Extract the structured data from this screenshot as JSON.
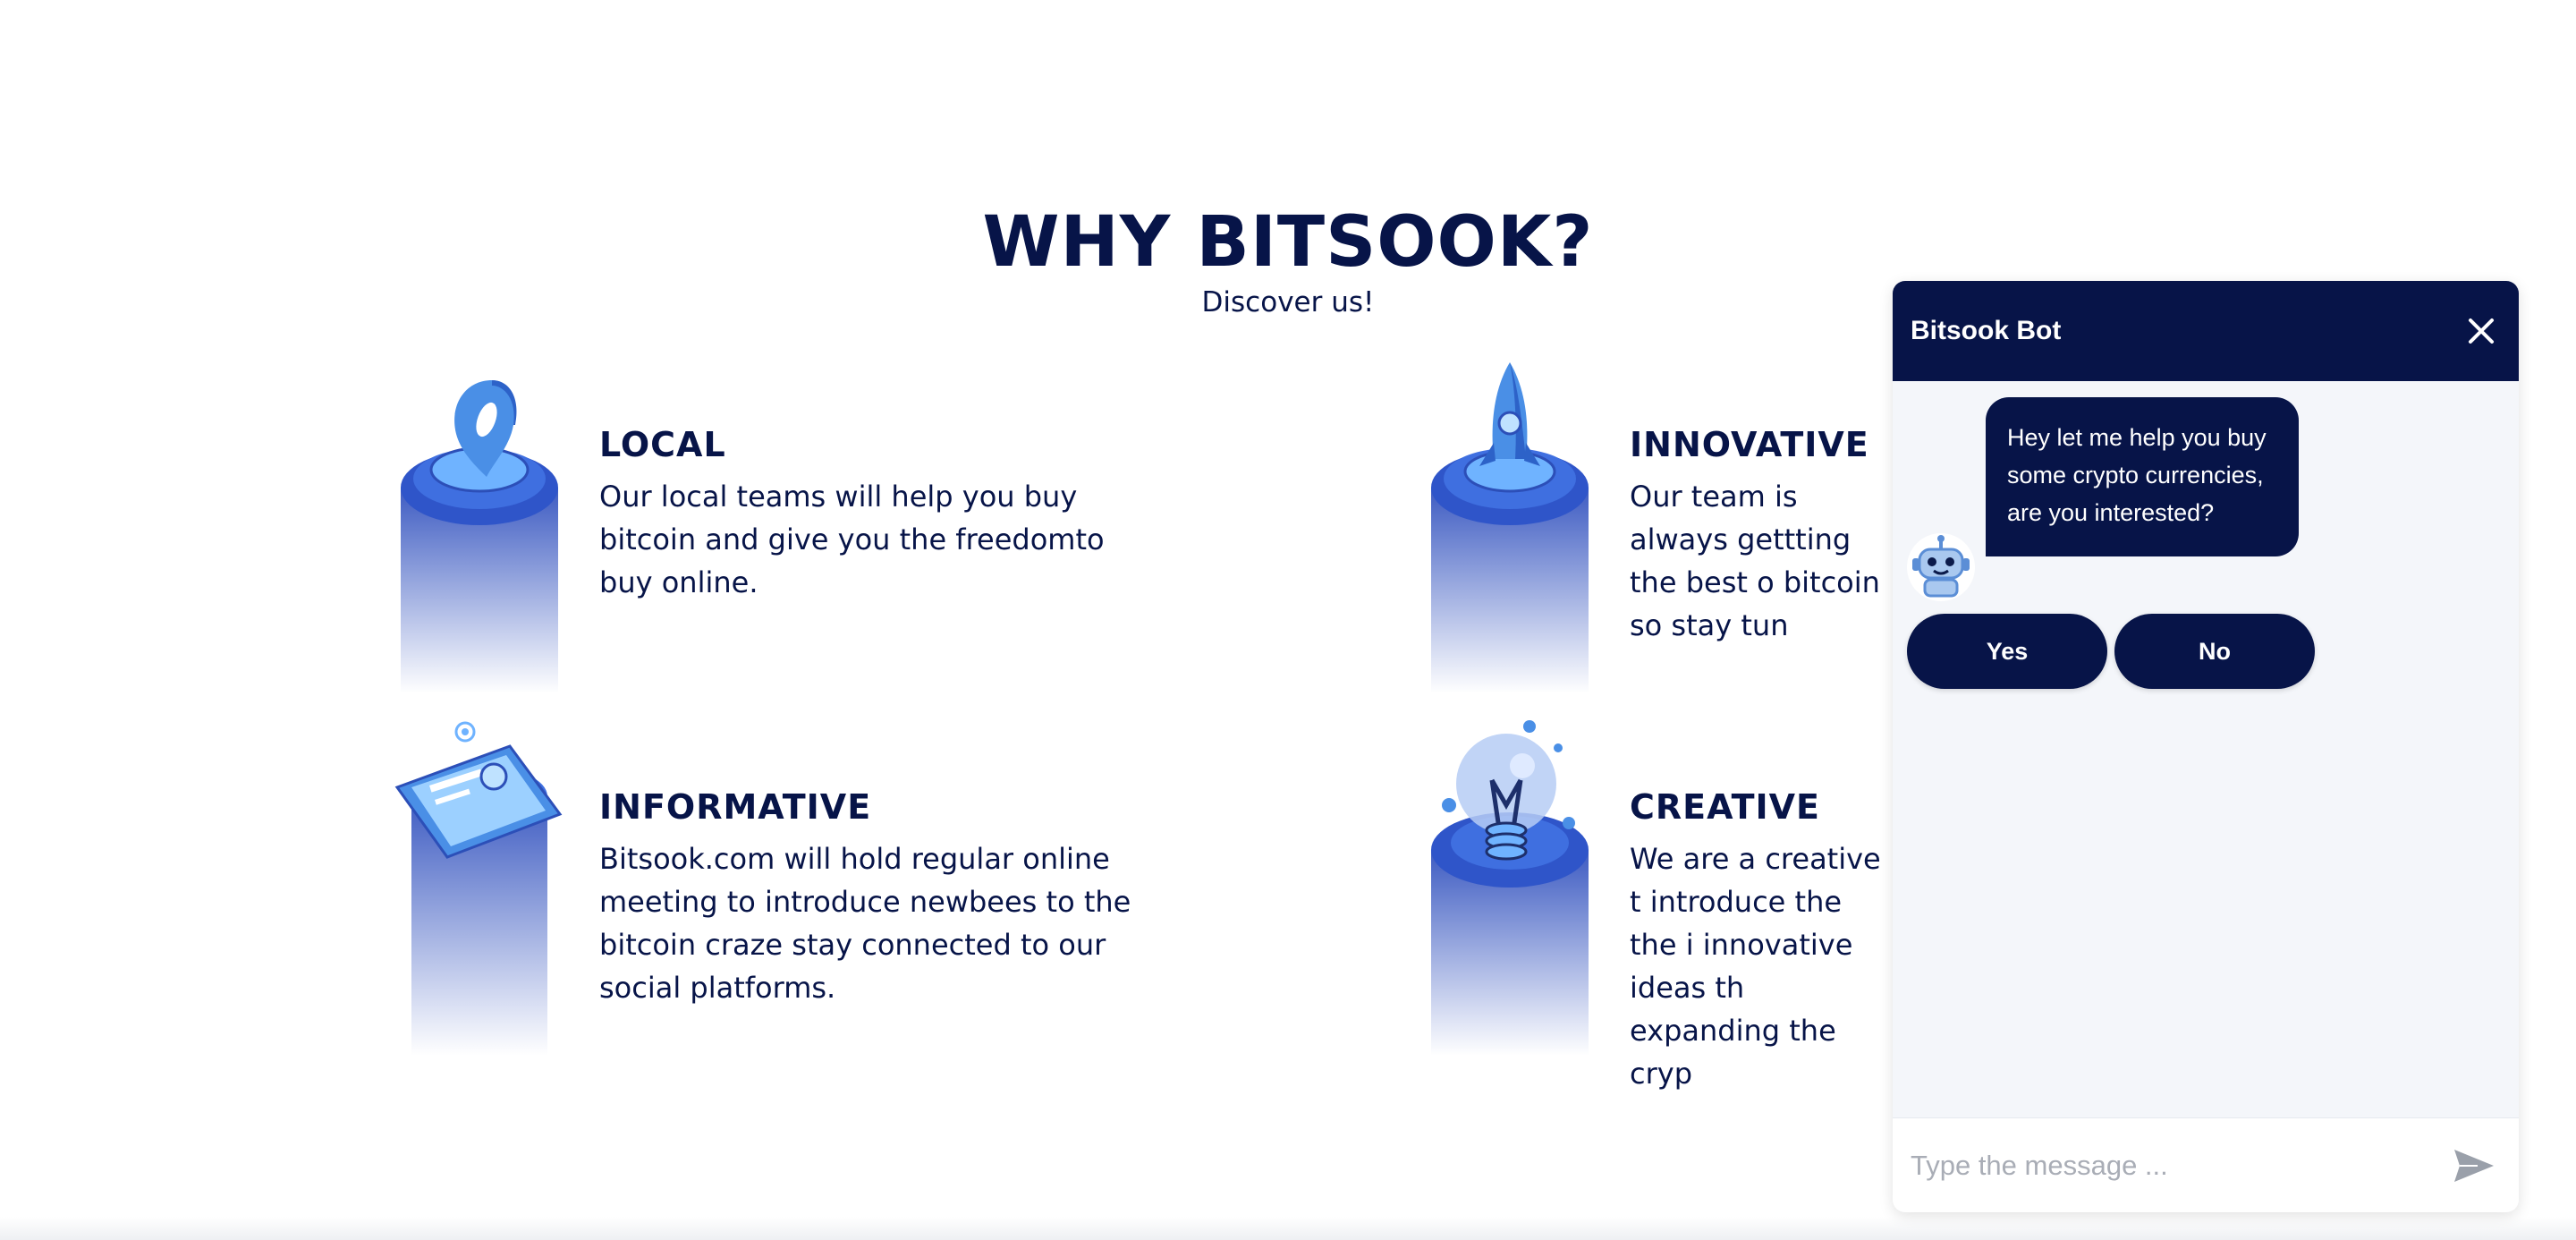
{
  "section": {
    "title": "WHY BITSOOK?",
    "subtitle": "Discover us!"
  },
  "features": [
    {
      "title": "LOCAL",
      "description": "Our local teams will help you buy bitcoin and give you the freedomto buy online.",
      "icon": "location-pin-icon"
    },
    {
      "title": "INNOVATIVE",
      "description": "Our team is always gettting the best o bitcoin so stay tun",
      "icon": "rocket-icon"
    },
    {
      "title": "INFORMATIVE",
      "description": "Bitsook.com will hold regular online meeting to introduce newbees to the bitcoin craze stay connected to our social platforms.",
      "icon": "phone-icon"
    },
    {
      "title": "CREATIVE",
      "description": "We are a creative t introduce the the i innovative ideas th expanding the cryp",
      "icon": "lightbulb-icon"
    }
  ],
  "chat": {
    "title": "Bitsook Bot",
    "message": "Hey let me help you buy some crypto currencies, are you interested?",
    "quick_replies": [
      "Yes",
      "No"
    ],
    "input_placeholder": "Type the message ...",
    "avatar_icon": "robot-icon",
    "colors": {
      "header": "#071448",
      "panel": "#f4f6fa"
    }
  }
}
